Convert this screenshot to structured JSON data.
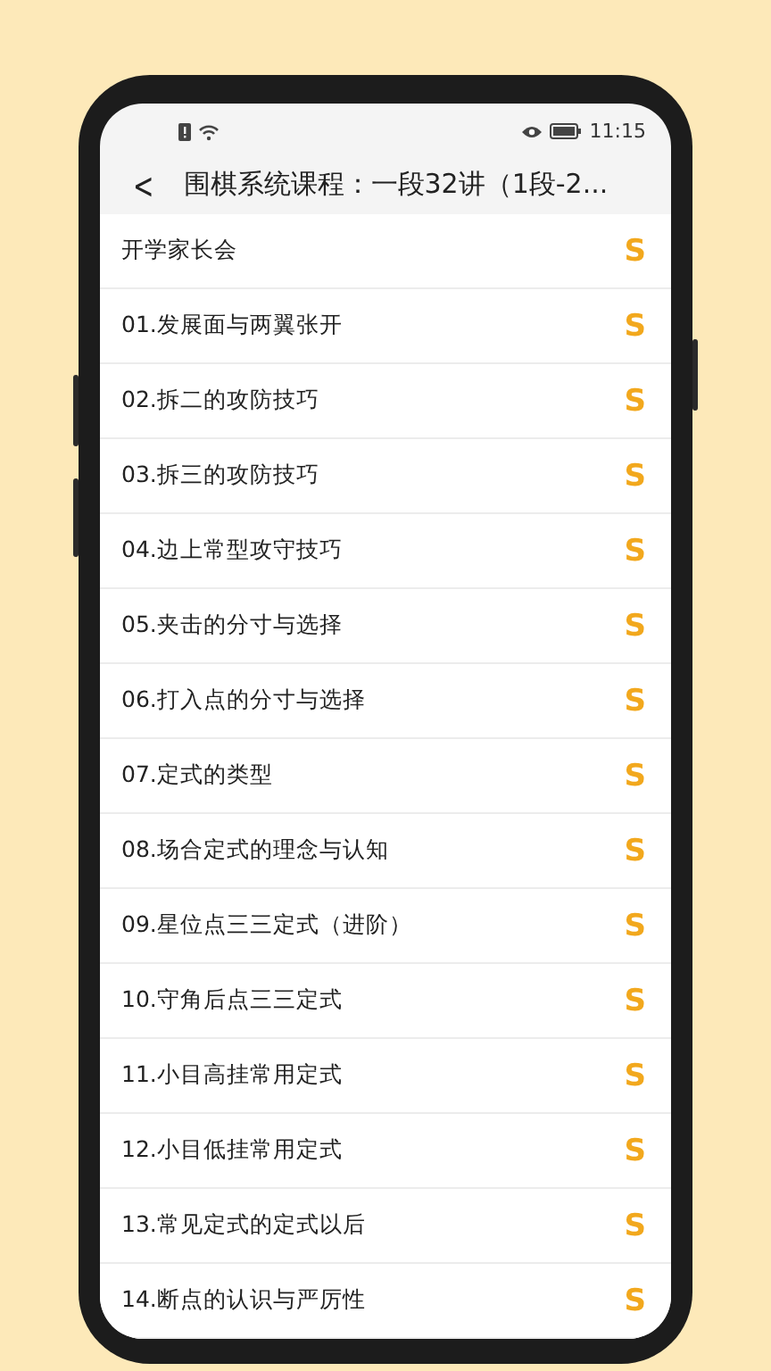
{
  "status_bar": {
    "time": "11:15"
  },
  "header": {
    "back": "<",
    "title": "围棋系统课程：一段32讲（1段-2..."
  },
  "lessons": [
    {
      "title": "开学家长会",
      "badge": "S"
    },
    {
      "title": "01.发展面与两翼张开",
      "badge": "S"
    },
    {
      "title": "02.拆二的攻防技巧",
      "badge": "S"
    },
    {
      "title": "03.拆三的攻防技巧",
      "badge": "S"
    },
    {
      "title": "04.边上常型攻守技巧",
      "badge": "S"
    },
    {
      "title": "05.夹击的分寸与选择",
      "badge": "S"
    },
    {
      "title": "06.打入点的分寸与选择",
      "badge": "S"
    },
    {
      "title": "07.定式的类型",
      "badge": "S"
    },
    {
      "title": "08.场合定式的理念与认知",
      "badge": "S"
    },
    {
      "title": "09.星位点三三定式（进阶）",
      "badge": "S"
    },
    {
      "title": "10.守角后点三三定式",
      "badge": "S"
    },
    {
      "title": "11.小目高挂常用定式",
      "badge": "S"
    },
    {
      "title": "12.小目低挂常用定式",
      "badge": "S"
    },
    {
      "title": "13.常见定式的定式以后",
      "badge": "S"
    },
    {
      "title": "14.断点的认识与严厉性",
      "badge": "S"
    }
  ]
}
